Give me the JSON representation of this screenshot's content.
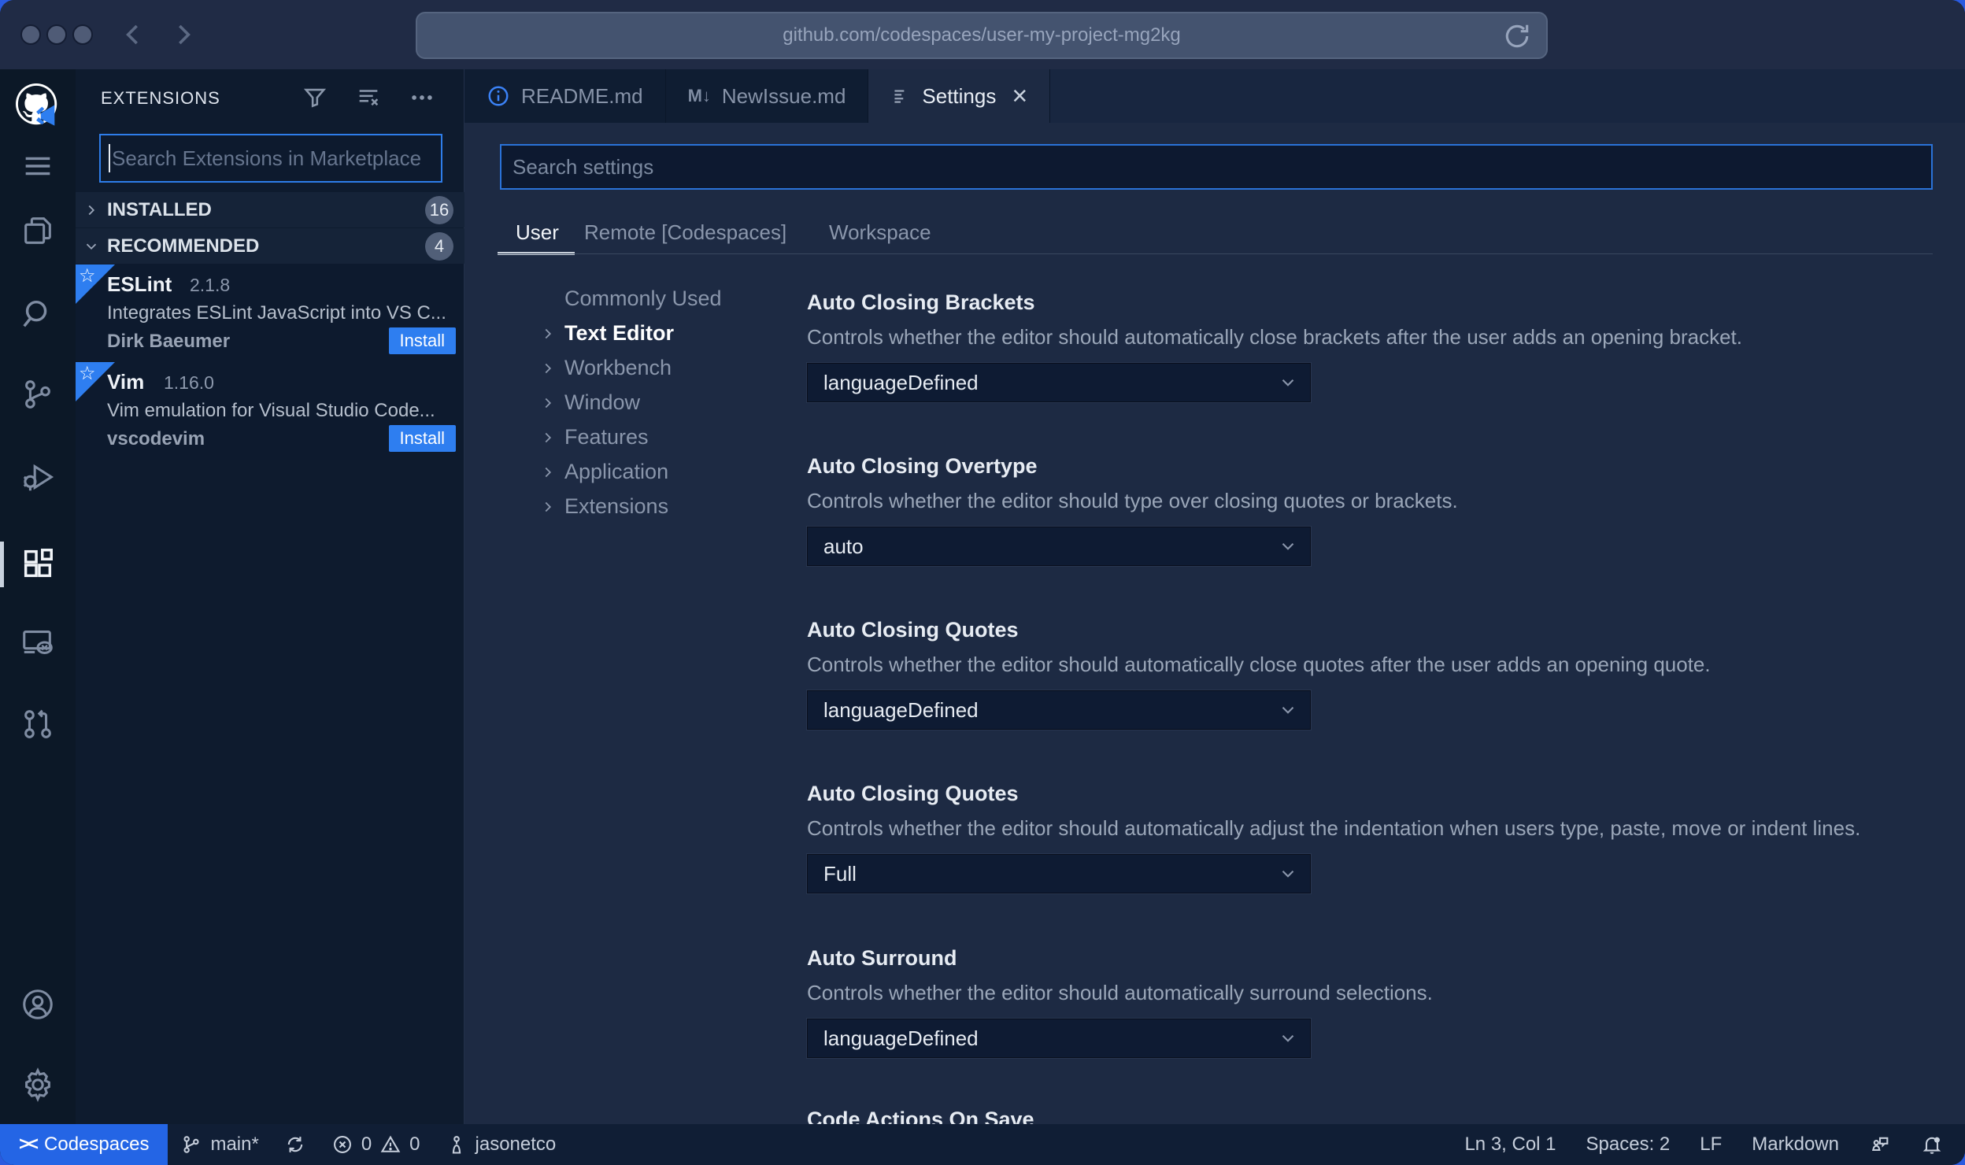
{
  "browser": {
    "url": "github.com/codespaces/user-my-project-mg2kg"
  },
  "activity_bar": {
    "icons": [
      "github-codespaces-logo",
      "menu",
      "explorer",
      "search",
      "source-control",
      "run-debug",
      "extensions",
      "remote-explorer",
      "pull-request",
      "account",
      "settings-gear"
    ],
    "active": "extensions"
  },
  "sidebar": {
    "title": "EXTENSIONS",
    "header_icons": [
      "filter-icon",
      "clear-extension-search-icon",
      "more-actions-icon"
    ],
    "search": {
      "placeholder": "Search Extensions in Marketplace",
      "value": ""
    },
    "sections": [
      {
        "label": "INSTALLED",
        "count": "16",
        "state": "collapsed"
      },
      {
        "label": "RECOMMENDED",
        "count": "4",
        "state": "expanded"
      }
    ],
    "extensions": [
      {
        "name": "ESLint",
        "version": "2.1.8",
        "description": "Integrates ESLint JavaScript into VS C...",
        "author": "Dirk Baeumer",
        "action": "Install",
        "recommended_star": "☆"
      },
      {
        "name": "Vim",
        "version": "1.16.0",
        "description": "Vim emulation for Visual Studio Code...",
        "author": "vscodevim",
        "action": "Install",
        "recommended_star": "☆"
      }
    ]
  },
  "tabs": [
    {
      "label": "README.md",
      "icon": "info-icon",
      "active": false
    },
    {
      "label": "NewIssue.md",
      "icon": "markdown-icon",
      "icon_glyph": "M↓",
      "active": false
    },
    {
      "label": "Settings",
      "icon": "settings-editor-icon",
      "active": true,
      "close_glyph": "×"
    }
  ],
  "settings": {
    "search": {
      "placeholder": "Search settings",
      "value": ""
    },
    "scope_tabs": [
      {
        "label": "User",
        "active": true
      },
      {
        "label": "Remote [Codespaces]",
        "active": false
      },
      {
        "label": "Workspace",
        "active": false
      }
    ],
    "toc": [
      {
        "label": "Commonly Used",
        "has_chevron": false,
        "active": false
      },
      {
        "label": "Text Editor",
        "has_chevron": true,
        "active": true
      },
      {
        "label": "Workbench",
        "has_chevron": true,
        "active": false
      },
      {
        "label": "Window",
        "has_chevron": true,
        "active": false
      },
      {
        "label": "Features",
        "has_chevron": true,
        "active": false
      },
      {
        "label": "Application",
        "has_chevron": true,
        "active": false
      },
      {
        "label": "Extensions",
        "has_chevron": true,
        "active": false
      }
    ],
    "items": [
      {
        "title": "Auto Closing Brackets",
        "description": "Controls whether the editor should automatically close brackets after the user adds an opening bracket.",
        "value": "languageDefined"
      },
      {
        "title": "Auto Closing Overtype",
        "description": "Controls whether the editor should type over closing quotes or brackets.",
        "value": "auto"
      },
      {
        "title": "Auto Closing Quotes",
        "description": "Controls whether the editor should automatically close quotes after the user adds an opening quote.",
        "value": "languageDefined"
      },
      {
        "title": "Auto Closing Quotes",
        "description": "Controls whether the editor should automatically adjust the indentation when users type, paste, move or indent lines.",
        "value": "Full"
      },
      {
        "title": "Auto Surround",
        "description": "Controls whether the editor should automatically surround selections.",
        "value": "languageDefined"
      },
      {
        "title": "Code Actions On Save"
      }
    ]
  },
  "status_bar": {
    "remote_label": "Codespaces",
    "remote_glyph": "><",
    "branch": "main*",
    "errors": "0",
    "warnings": "0",
    "user": "jasonetco",
    "line_col": "Ln 3, Col 1",
    "indentation": "Spaces: 2",
    "eol": "LF",
    "language": "Markdown"
  },
  "colors": {
    "accent_blue": "#2e7ef0",
    "focus_border": "#2e7de9",
    "statusbar_remote_bg": "#2465e5",
    "editor_bg": "#1d2a43",
    "sidebar_bg": "#0e1b2e",
    "activitybar_bg": "#0c1827",
    "chrome_bg": "#202b45"
  }
}
